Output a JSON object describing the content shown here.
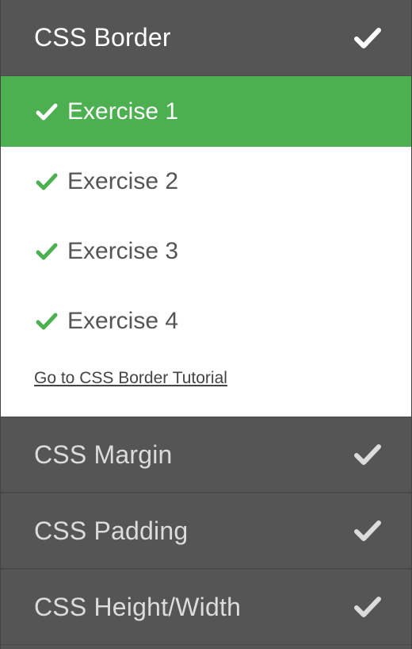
{
  "active_section": {
    "title": "CSS Border",
    "completed": true,
    "exercises": [
      {
        "label": "Exercise 1",
        "completed": true,
        "active": true
      },
      {
        "label": "Exercise 2",
        "completed": true,
        "active": false
      },
      {
        "label": "Exercise 3",
        "completed": true,
        "active": false
      },
      {
        "label": "Exercise 4",
        "completed": true,
        "active": false
      }
    ],
    "tutorial_link": "Go to CSS Border Tutorial"
  },
  "other_sections": [
    {
      "title": "CSS Margin",
      "completed": true
    },
    {
      "title": "CSS Padding",
      "completed": true
    },
    {
      "title": "CSS Height/Width",
      "completed": true
    }
  ],
  "colors": {
    "panel_bg": "#555555",
    "active_green": "#4CAF50",
    "check_green": "#4CAF50",
    "list_bg": "#ffffff"
  },
  "icons": {
    "section_check": "checkmark-icon",
    "exercise_check": "checkmark-icon"
  }
}
